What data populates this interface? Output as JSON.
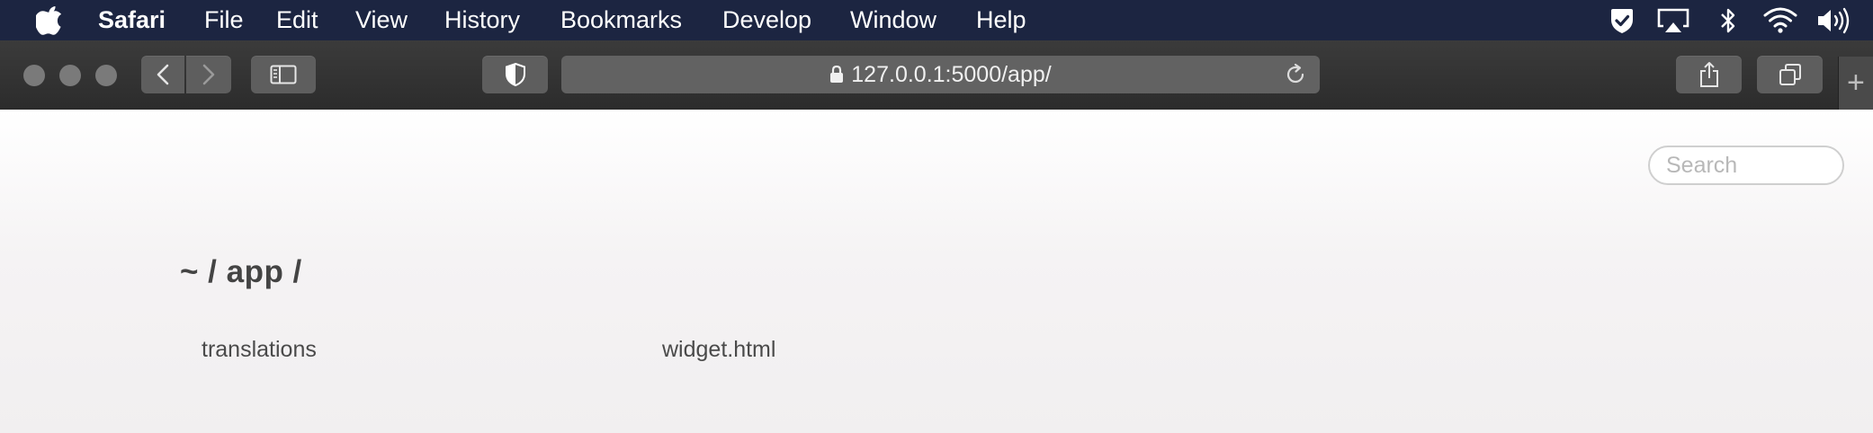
{
  "menubar": {
    "app_name": "Safari",
    "items": [
      "File",
      "Edit",
      "View",
      "History",
      "Bookmarks",
      "Develop",
      "Window",
      "Help"
    ]
  },
  "toolbar": {
    "url": "127.0.0.1:5000/app/"
  },
  "page": {
    "search_placeholder": "Search",
    "breadcrumb": "~ / app /",
    "files": [
      "translations",
      "widget.html"
    ]
  },
  "colors": {
    "menubar_bg": "#1c2541",
    "toolbar_bg": "#333333",
    "page_bg": "#f3f1f2",
    "text": "#444444"
  }
}
